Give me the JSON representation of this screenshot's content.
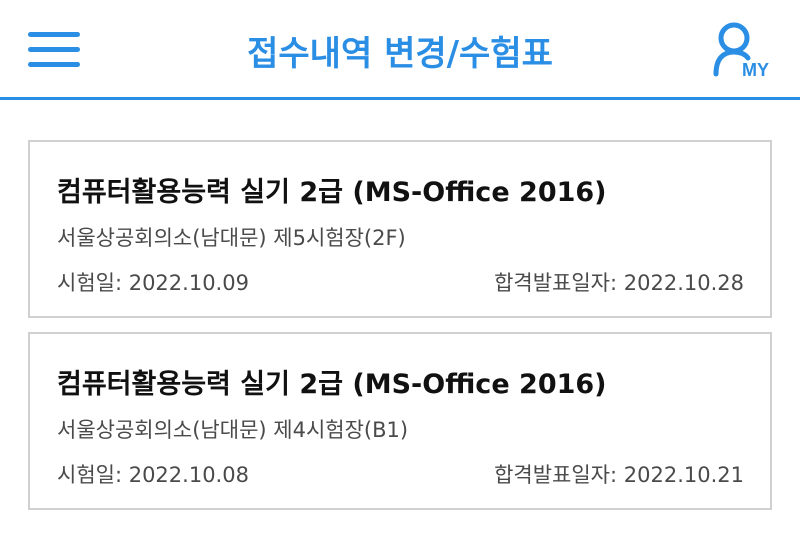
{
  "header": {
    "title": "접수내역 변경/수험표",
    "menu_icon": "hamburger-menu-icon",
    "my_icon": "user-icon",
    "my_label": "MY",
    "accent_color": "#2b8ee5"
  },
  "cards": [
    {
      "title": "컴퓨터활용능력 실기 2급 (MS-Office 2016)",
      "venue": "서울상공회의소(남대문) 제5시험장(2F)",
      "exam_date": "시험일: 2022.10.09",
      "result_date": "합격발표일자: 2022.10.28"
    },
    {
      "title": "컴퓨터활용능력 실기 2급 (MS-Office 2016)",
      "venue": "서울상공회의소(남대문) 제4시험장(B1)",
      "exam_date": "시험일: 2022.10.08",
      "result_date": "합격발표일자: 2022.10.21"
    }
  ]
}
